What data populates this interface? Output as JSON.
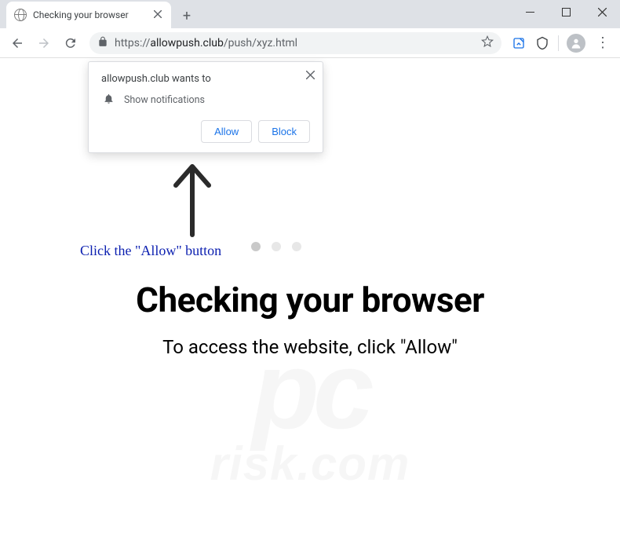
{
  "window": {
    "controls": {
      "min": "minimize",
      "max": "maximize",
      "close": "close"
    }
  },
  "tab": {
    "title": "Checking your browser"
  },
  "address": {
    "scheme": "https://",
    "host": "allowpush.club",
    "path": "/push/xyz.html"
  },
  "permission": {
    "title": "allowpush.club wants to",
    "item": "Show notifications",
    "allow": "Allow",
    "block": "Block"
  },
  "page": {
    "instruction": "Click the \"Allow\" button",
    "heading": "Checking your browser",
    "subheading": "To access the website, click \"Allow\""
  },
  "watermark": {
    "line1": "pc",
    "line2": "risk.com"
  }
}
